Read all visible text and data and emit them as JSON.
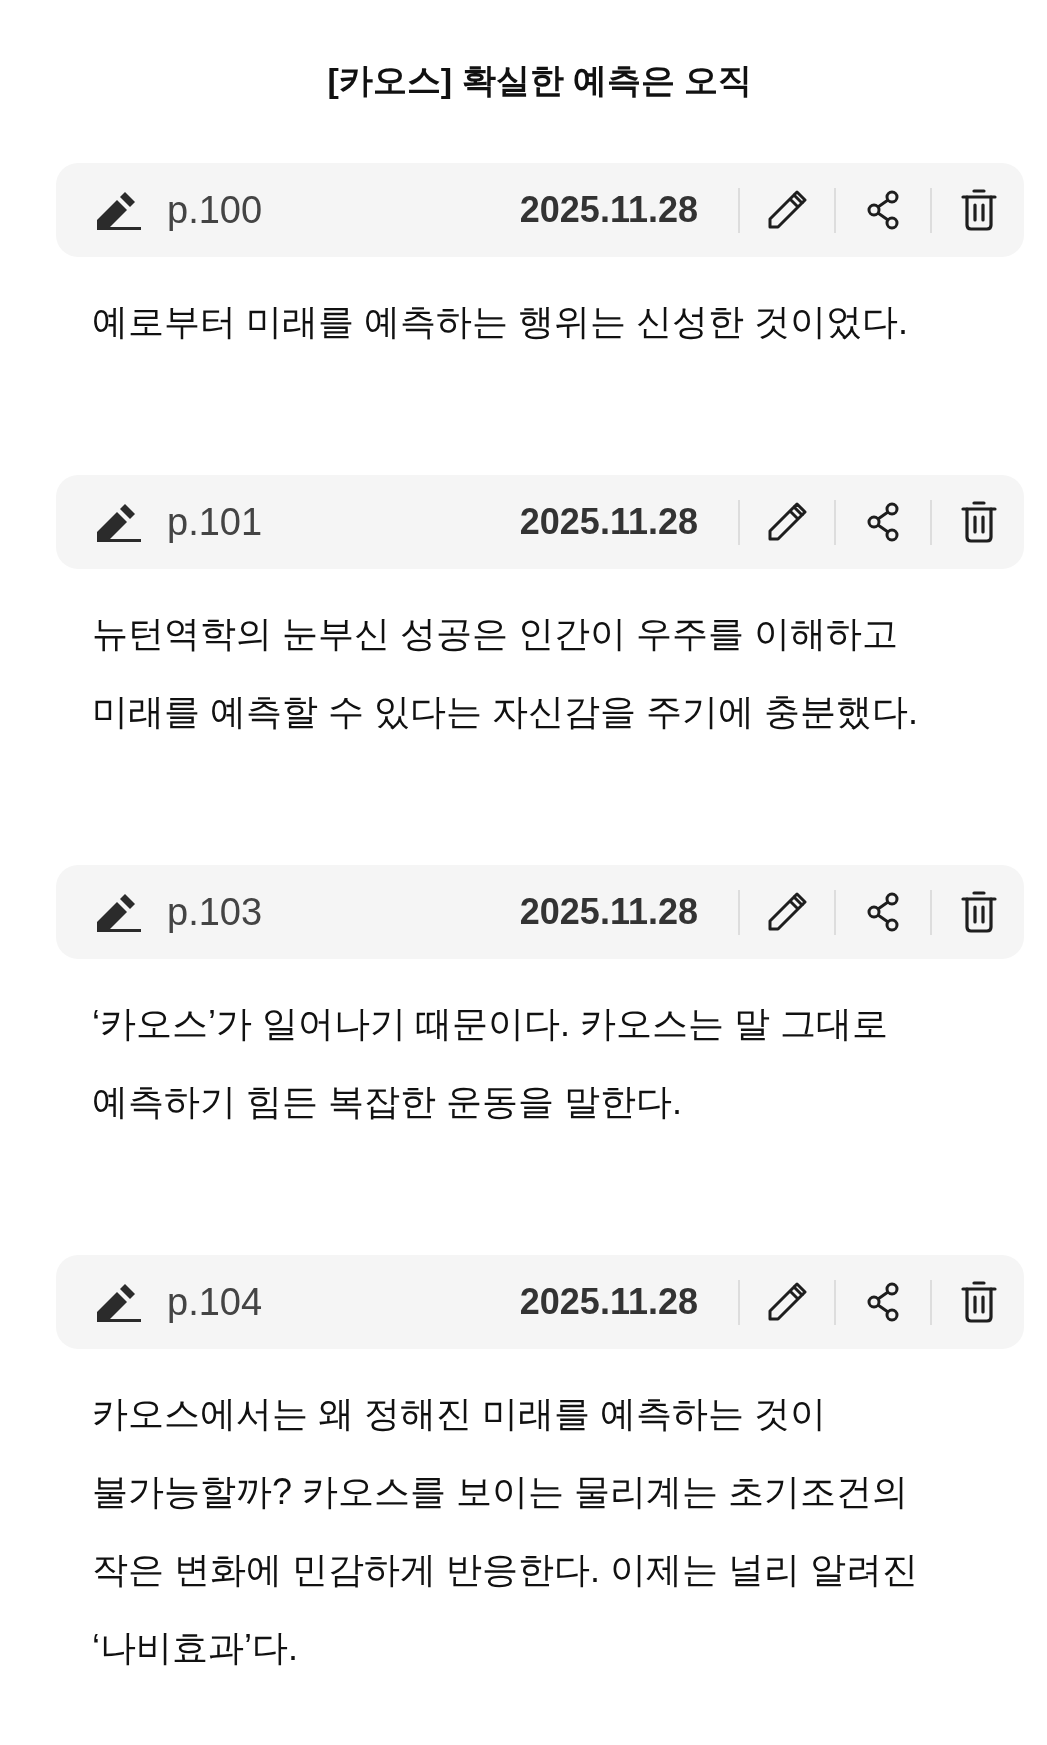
{
  "title": "[카오스] 확실한 예측은 오직",
  "notes": [
    {
      "page": "p.100",
      "date": "2025.11.28",
      "text": "예로부터 미래를 예측하는 행위는 신성한 것이었다."
    },
    {
      "page": "p.101",
      "date": "2025.11.28",
      "text": "뉴턴역학의 눈부신 성공은 인간이 우주를 이해하고 미래를 예측할 수 있다는 자신감을 주기에 충분했다."
    },
    {
      "page": "p.103",
      "date": "2025.11.28",
      "text": "‘카오스’가 일어나기 때문이다. 카오스는 말 그대로 예측하기 힘든 복잡한 운동을 말한다."
    },
    {
      "page": "p.104",
      "date": "2025.11.28",
      "text": "카오스에서는 왜 정해진 미래를 예측하는 것이 불가능할까? 카오스를 보이는 물리계는 초기조건의 작은 변화에 민감하게 반응한다. 이제는 널리 알려진 ‘나비효과’다."
    }
  ]
}
